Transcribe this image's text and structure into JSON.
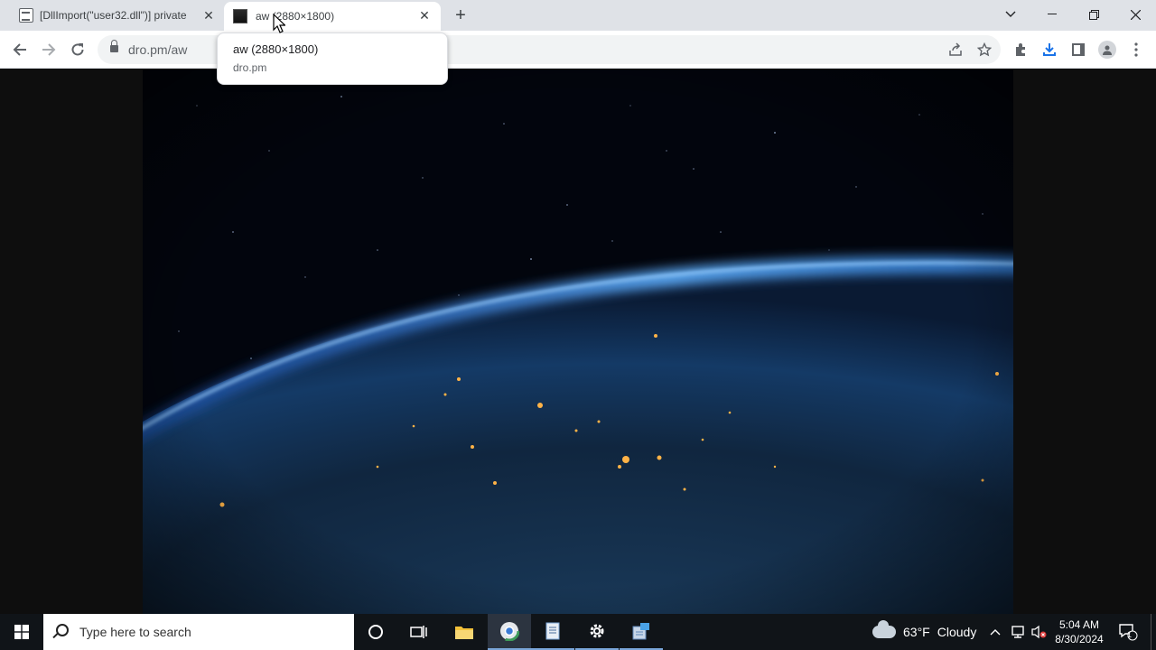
{
  "browser": {
    "tabs": [
      {
        "title": "[DllImport(\"user32.dll\")] private",
        "active": false
      },
      {
        "title": "aw (2880×1800)",
        "active": true
      }
    ],
    "new_tab_symbol": "+",
    "close_symbol": "✕",
    "address": "dro.pm/aw",
    "tooltip": {
      "title": "aw (2880×1800)",
      "subtitle": "dro.pm"
    }
  },
  "icons": {
    "back": "arrow-left-icon",
    "forward": "arrow-right-icon",
    "reload": "reload-icon",
    "share": "share-icon",
    "star": "star-icon",
    "extensions": "puzzle-icon",
    "download": "download-icon",
    "side_panel": "side-panel-icon",
    "profile": "profile-icon",
    "menu": "kebab-menu-icon"
  },
  "taskbar": {
    "search_placeholder": "Type here to search",
    "weather": {
      "temp": "63°F",
      "condition": "Cloudy"
    },
    "time": "5:04 AM",
    "date": "8/30/2024",
    "notification_count": "1"
  },
  "colors": {
    "tabstrip": "#dfe2e7",
    "download_accent": "#1a73e8",
    "taskbar": "#101418"
  }
}
